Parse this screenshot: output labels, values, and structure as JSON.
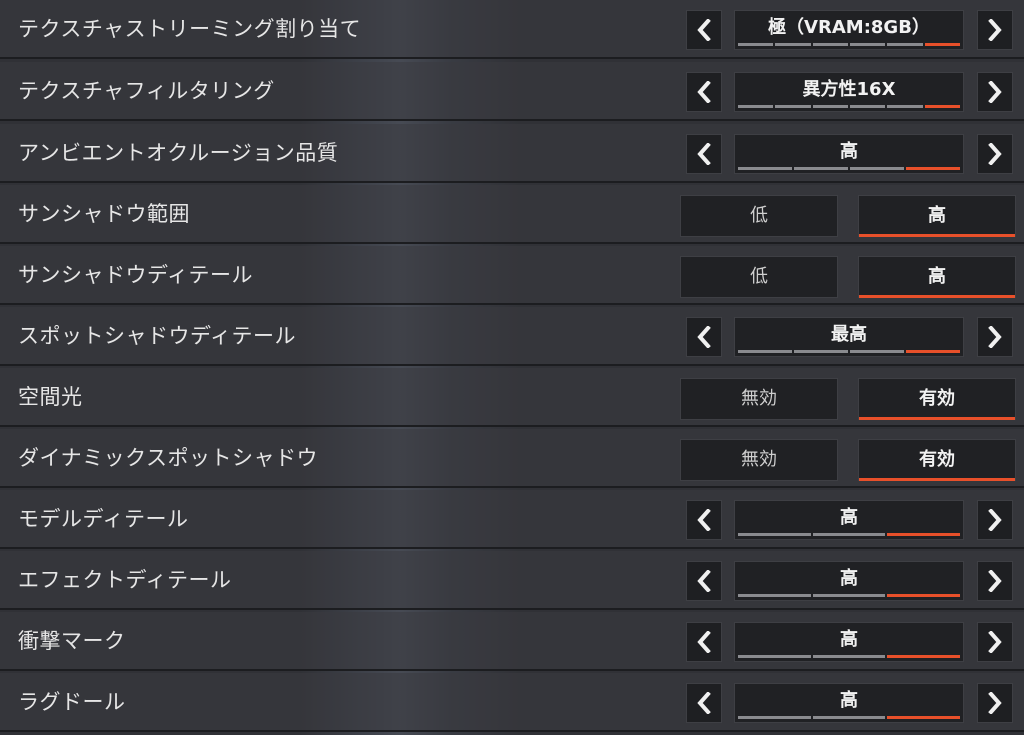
{
  "colors": {
    "accent": "#e8502a",
    "row_bg": "#3a3b40",
    "control_bg": "#202124",
    "tick_inactive": "#8a8b8f"
  },
  "settings": [
    {
      "label": "テクスチャストリーミング割り当て",
      "type": "carousel",
      "value": "極（VRAM:8GB）",
      "levels": 6,
      "active_level": 6
    },
    {
      "label": "テクスチャフィルタリング",
      "type": "carousel",
      "value": "異方性16X",
      "levels": 6,
      "active_level": 6
    },
    {
      "label": "アンビエントオクルージョン品質",
      "type": "carousel",
      "value": "高",
      "levels": 4,
      "active_level": 4
    },
    {
      "label": "サンシャドウ範囲",
      "type": "toggle",
      "options": [
        "低",
        "高"
      ],
      "selected": 1
    },
    {
      "label": "サンシャドウディテール",
      "type": "toggle",
      "options": [
        "低",
        "高"
      ],
      "selected": 1
    },
    {
      "label": "スポットシャドウディテール",
      "type": "carousel",
      "value": "最高",
      "levels": 4,
      "active_level": 4
    },
    {
      "label": "空間光",
      "type": "toggle",
      "options": [
        "無効",
        "有効"
      ],
      "selected": 1
    },
    {
      "label": "ダイナミックスポットシャドウ",
      "type": "toggle",
      "options": [
        "無効",
        "有効"
      ],
      "selected": 1
    },
    {
      "label": "モデルディテール",
      "type": "carousel",
      "value": "高",
      "levels": 3,
      "active_level": 3
    },
    {
      "label": "エフェクトディテール",
      "type": "carousel",
      "value": "高",
      "levels": 3,
      "active_level": 3
    },
    {
      "label": "衝撃マーク",
      "type": "carousel",
      "value": "高",
      "levels": 3,
      "active_level": 3
    },
    {
      "label": "ラグドール",
      "type": "carousel",
      "value": "高",
      "levels": 3,
      "active_level": 3
    }
  ],
  "icons": {
    "prev": "chevron-left-icon",
    "next": "chevron-right-icon"
  }
}
